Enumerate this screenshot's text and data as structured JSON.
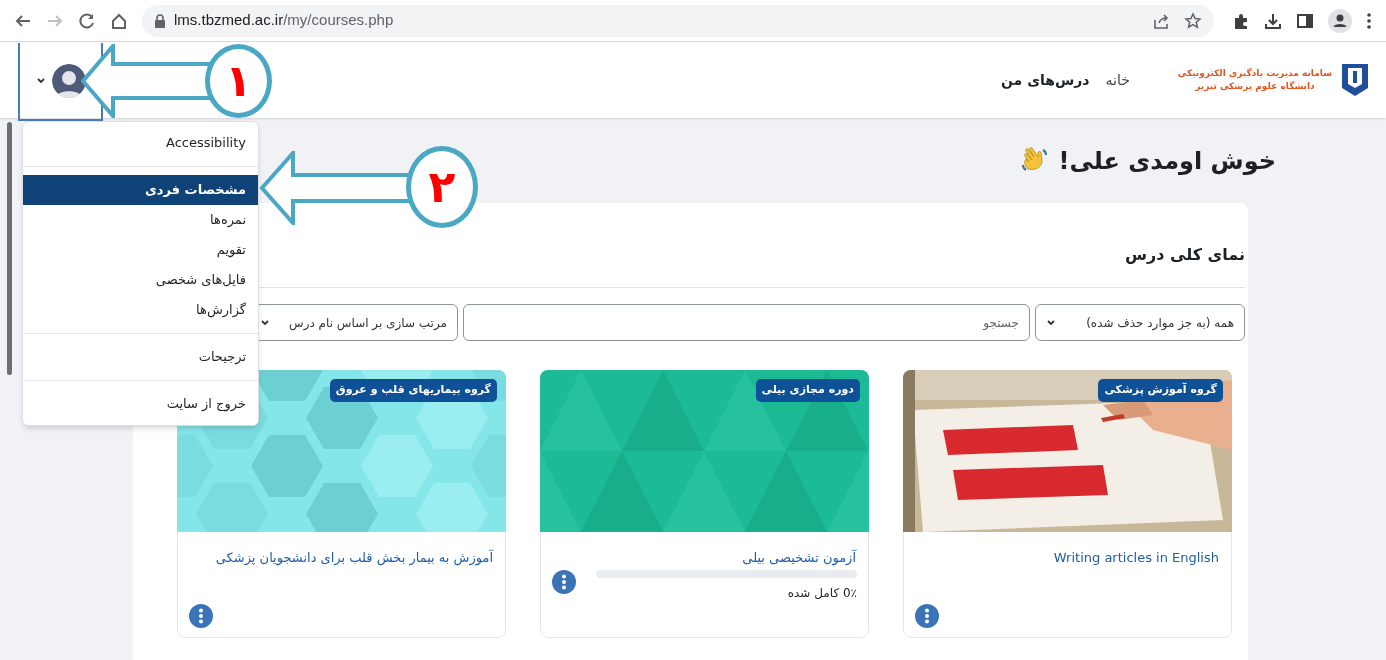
{
  "browser": {
    "url_host": "lms.tbzmed.ac.ir",
    "url_path": "/my/courses.php"
  },
  "header": {
    "logo_lines": [
      "سامانه مدیریت یادگیری الکترونیکی",
      "دانشگاه علوم پزشکی تبریز"
    ],
    "nav": [
      {
        "label": "خانه",
        "selected": false
      },
      {
        "label": "درس‌های من",
        "selected": true
      }
    ]
  },
  "user_menu": {
    "expanded": true,
    "sections": [
      [
        {
          "label": "Accessibility",
          "selected": false
        }
      ],
      [
        {
          "label": "مشخصات فردی",
          "selected": true
        },
        {
          "label": "نمره‌ها",
          "selected": false
        },
        {
          "label": "تقویم",
          "selected": false
        },
        {
          "label": "فایل‌های شخصی",
          "selected": false
        },
        {
          "label": "گزارش‌ها",
          "selected": false
        }
      ],
      [
        {
          "label": "ترجیحات",
          "selected": false
        }
      ],
      [
        {
          "label": "خروج از سایت",
          "selected": false
        }
      ]
    ]
  },
  "greeting": "خوش اومدی علی!",
  "overview": {
    "title": "نمای کلی درس",
    "filters": {
      "grouping": "همه (به جز موارد حذف شده)",
      "search_placeholder": "جستجو",
      "sort": "مرتب سازی بر اساس نام درس"
    },
    "courses": [
      {
        "category": "گروه آموزش پزشکی",
        "name": "Writing articles in English",
        "kind": "picture"
      },
      {
        "category": "دوره مجازی بیلی",
        "name": "آزمون تشخیصی بیلی",
        "kind": "triangles",
        "color": "#1dba96",
        "progress": {
          "level": 0,
          "label": "0٪ کامل شده"
        }
      },
      {
        "category": "گروه بیماریهای قلب و عروق",
        "name": "آموزش به بیمار بخش قلب برای دانشجویان پزشکی",
        "kind": "hexagons",
        "color": "#84e6e9"
      }
    ]
  },
  "annotations": [
    {
      "number": "۱"
    },
    {
      "number": "۲"
    }
  ]
}
